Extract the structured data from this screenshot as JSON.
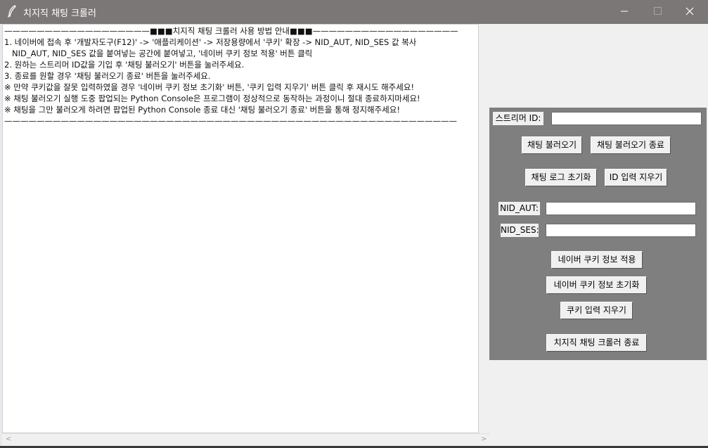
{
  "window": {
    "title": "치지직 채팅 크롤러",
    "minimize_glyph": "—",
    "maximize_glyph": "☐",
    "close_glyph": "✕",
    "app_icon": "feather-icon"
  },
  "log": {
    "lines": [
      "——————————————————■■■치지직 채팅 크롤러 사용 방법 안내■■■——————————————————",
      "1. 네이버에 접속 후 '개발자도구(F12)' -> '애플리케이션' -> 저장용량에서 '쿠키' 확장 -> NID_AUT, NID_SES 값 복사",
      "   NID_AUT, NID_SES 값을 붙여넣는 공간에 붙여넣고, '네이버 쿠키 정보 적용' 버튼 클릭",
      "2. 원하는 스트리머 ID값을 기입 후 '채팅 불러오기' 버튼을 눌러주세요.",
      "3. 종료를 원할 경우 '채팅 불러오기 종료' 버튼을 눌러주세요.",
      "※ 만약 쿠키값을 잘못 입력하였을 경우 '네이버 쿠키 정보 초기화' 버튼, '쿠키 입력 지우기' 버튼 클릭 후 재시도 해주세요!",
      "※ 채팅 불러오기 실행 도중 팝업되는 Python Console은 프로그램이 정상적으로 동작하는 과정이니 절대 종료하지마세요!",
      "※ 채팅을 그만 불러오게 하려면 팝업된 Python Console 종료 대신 '채팅 불러오기 종료' 버튼을 통해 정지해주세요!",
      "————————————————————————————————————————————————————————"
    ]
  },
  "controls": {
    "streamer_id_label": "스트리머 ID:",
    "streamer_id_value": "",
    "load_chat": "채팅 불러오기",
    "stop_chat": "채팅 불러오기 종료",
    "reset_log": "채팅 로그 초기화",
    "clear_id": "ID 입력 지우기",
    "nid_aut_label": "NID_AUT:",
    "nid_aut_value": "",
    "nid_ses_label": "NID_SES:",
    "nid_ses_value": "",
    "apply_cookie": "네이버 쿠키 정보 적용",
    "reset_cookie": "네이버 쿠키 정보 초기화",
    "clear_cookie": "쿠키 입력 지우기",
    "exit_app": "치지직 채팅 크롤러 종료"
  },
  "scrollbar": {
    "left_arrow": "<",
    "right_arrow": ">"
  }
}
